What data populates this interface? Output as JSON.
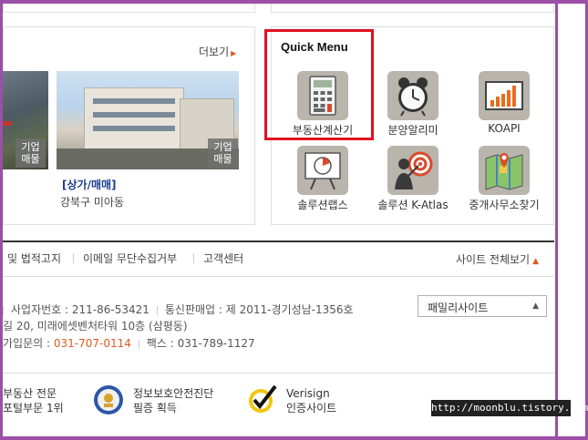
{
  "listing_panel": {
    "more_label": "더보기",
    "badge_label": "기업\n매물",
    "badge_line1": "기업",
    "badge_line2": "매물",
    "item_title": "[상가/매매]",
    "item_location": "강북구 미아동"
  },
  "quick_menu": {
    "title": "Quick Menu",
    "items": [
      {
        "label": "부동산계산기",
        "icon": "calculator-icon"
      },
      {
        "label": "분양알리미",
        "icon": "alarm-clock-icon"
      },
      {
        "label": "KOAPI",
        "icon": "bar-chart-icon"
      },
      {
        "label": "솔루션랩스",
        "icon": "presentation-board-icon"
      },
      {
        "label": "솔루션 K-Atlas",
        "icon": "target-person-icon"
      },
      {
        "label": "중개사무소찾기",
        "icon": "map-icon"
      }
    ],
    "highlight_color": "#e0101f"
  },
  "footer_nav": {
    "items": [
      "및 법적고지",
      "이메일 무단수집거부",
      "고객센터"
    ],
    "sitemap_label": "사이트 전체보기"
  },
  "company_info": {
    "line1_a": "사업자번호 : 211-86-53421",
    "line1_b": "통신판매업 : 제 2011-경기성남-1356호",
    "line2": "길 20, 미래에셋벤처타워 10층 (삼평동)",
    "line3_prefix": "가입문의 : ",
    "line3_phone": "031-707-0114",
    "line3_fax": "팩스 : 031-789-1127"
  },
  "family_site": {
    "label": "패밀리사이트"
  },
  "certifications": [
    {
      "line1": "부동산 전문",
      "line2": "포털부문 1위"
    },
    {
      "line1": "정보보호안전진단",
      "line2": "필증 획득"
    },
    {
      "line1": "Verisign",
      "line2": "인증사이트"
    }
  ],
  "watermark": "http://moonblu.tistory.com",
  "colors": {
    "frame": "#9b4fa6",
    "accent": "#e05a20",
    "title_blue": "#1b3f8f"
  }
}
